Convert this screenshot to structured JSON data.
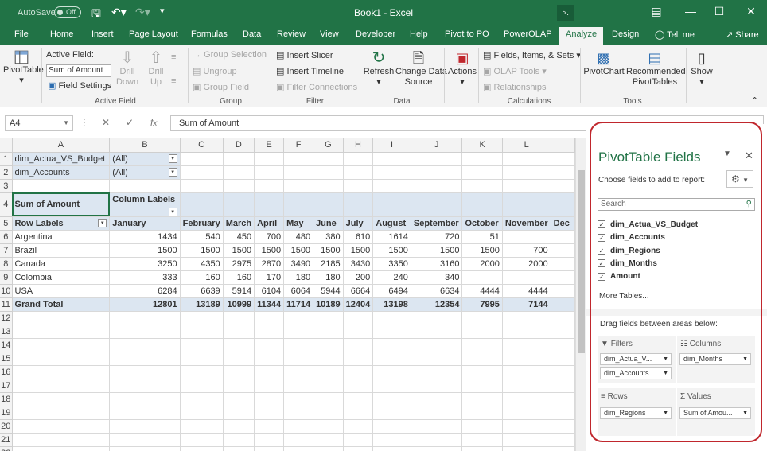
{
  "titlebar": {
    "autosave": "AutoSave",
    "toggle": "Off",
    "title": "Book1 - Excel",
    "small_box": ">."
  },
  "tabs": [
    "File",
    "Home",
    "Insert",
    "Page Layout",
    "Formulas",
    "Data",
    "Review",
    "View",
    "Developer",
    "Help",
    "Pivot to PO",
    "PowerOLAP",
    "Analyze",
    "Design"
  ],
  "tellme": "Tell me",
  "share": "Share",
  "ribbon": {
    "pivottable": "PivotTable",
    "active_field_label": "Active Field:",
    "active_field_value": "Sum of Amount",
    "field_settings": "Field Settings",
    "drill_down": "Drill\nDown",
    "drill_up": "Drill\nUp",
    "group_selection": "Group Selection",
    "ungroup": "Ungroup",
    "group_field": "Group Field",
    "insert_slicer": "Insert Slicer",
    "insert_timeline": "Insert Timeline",
    "filter_connections": "Filter Connections",
    "refresh": "Refresh",
    "change_data_source": "Change Data\nSource",
    "actions": "Actions",
    "fields_items_sets": "Fields, Items, & Sets",
    "olap_tools": "OLAP Tools",
    "relationships": "Relationships",
    "pivotchart": "PivotChart",
    "recommended": "Recommended\nPivotTables",
    "show": "Show",
    "groups": {
      "active_field": "Active Field",
      "group": "Group",
      "filter": "Filter",
      "data": "Data",
      "calculations": "Calculations",
      "tools": "Tools"
    }
  },
  "formula_bar": {
    "name_box": "A4",
    "formula": "Sum of Amount"
  },
  "sheet": {
    "columns": [
      "A",
      "B",
      "C",
      "D",
      "E",
      "F",
      "G",
      "H",
      "I",
      "J",
      "K",
      "L"
    ],
    "filters": [
      {
        "name": "dim_Actua_VS_Budget",
        "value": "(All)"
      },
      {
        "name": "dim_Accounts",
        "value": "(All)"
      }
    ],
    "pivot_header": {
      "corner": "Sum of Amount",
      "col_labels": "Column Labels",
      "row_labels": "Row Labels"
    },
    "months": [
      "January",
      "February",
      "March",
      "April",
      "May",
      "June",
      "July",
      "August",
      "September",
      "October",
      "November",
      "Dec"
    ],
    "rows": [
      {
        "label": "Argentina",
        "values": [
          "1434",
          "540",
          "450",
          "700",
          "480",
          "380",
          "610",
          "1614",
          "720",
          "51",
          "",
          ""
        ]
      },
      {
        "label": "Brazil",
        "values": [
          "1500",
          "1500",
          "1500",
          "1500",
          "1500",
          "1500",
          "1500",
          "1500",
          "1500",
          "1500",
          "700",
          ""
        ]
      },
      {
        "label": "Canada",
        "values": [
          "3250",
          "4350",
          "2975",
          "2870",
          "3490",
          "2185",
          "3430",
          "3350",
          "3160",
          "2000",
          "2000",
          ""
        ]
      },
      {
        "label": "Colombia",
        "values": [
          "333",
          "160",
          "160",
          "170",
          "180",
          "180",
          "200",
          "240",
          "340",
          "",
          "",
          ""
        ]
      },
      {
        "label": "USA",
        "values": [
          "6284",
          "6639",
          "5914",
          "6104",
          "6064",
          "5944",
          "6664",
          "6494",
          "6634",
          "4444",
          "4444",
          ""
        ]
      }
    ],
    "grand_total": {
      "label": "Grand Total",
      "values": [
        "12801",
        "13189",
        "10999",
        "11344",
        "11714",
        "10189",
        "12404",
        "13198",
        "12354",
        "7995",
        "7144",
        ""
      ]
    },
    "row_numbers": [
      "1",
      "2",
      "3",
      "4",
      "5",
      "6",
      "7",
      "8",
      "9",
      "10",
      "11",
      "12",
      "13",
      "14",
      "15",
      "16",
      "17",
      "18",
      "19",
      "20",
      "21",
      "22"
    ]
  },
  "pane": {
    "title": "PivotTable Fields",
    "subtitle": "Choose fields to add to report:",
    "search_placeholder": "Search",
    "fields": [
      "dim_Actua_VS_Budget",
      "dim_Accounts",
      "dim_Regions",
      "dim_Months",
      "Amount"
    ],
    "more_tables": "More Tables...",
    "drag_hint": "Drag fields between areas below:",
    "areas": {
      "filters": {
        "label": "Filters",
        "items": [
          "dim_Actua_V...",
          "dim_Accounts"
        ]
      },
      "columns": {
        "label": "Columns",
        "items": [
          "dim_Months"
        ]
      },
      "rows": {
        "label": "Rows",
        "items": [
          "dim_Regions"
        ]
      },
      "values": {
        "label": "Values",
        "items": [
          "Sum of Amou..."
        ]
      }
    }
  }
}
